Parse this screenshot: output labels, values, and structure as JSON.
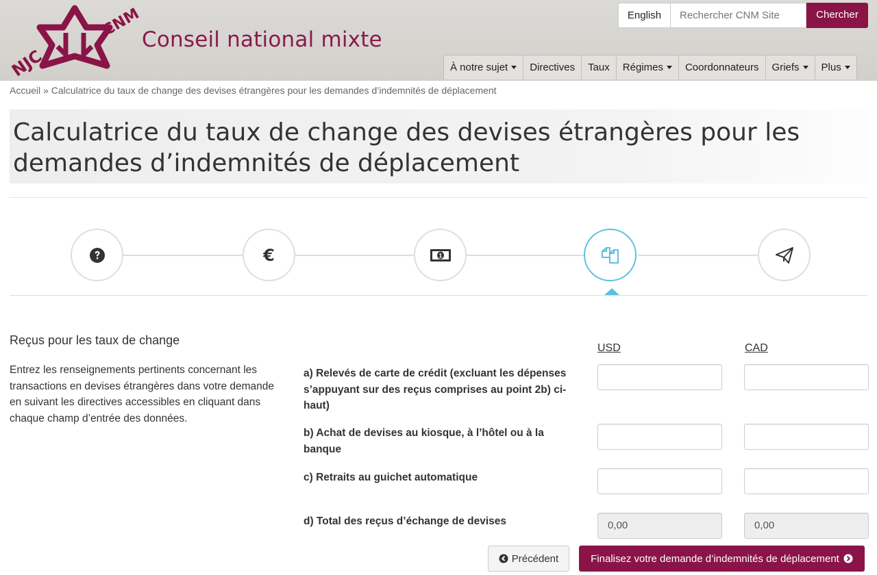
{
  "header": {
    "logo_left_text": "NJC",
    "logo_right_text": "CNM",
    "site_title": "Conseil national mixte",
    "lang_toggle": "English",
    "search_placeholder": "Rechercher CNM Site",
    "search_button": "Chercher",
    "brand_color": "#8a1447"
  },
  "nav": {
    "items": [
      {
        "label": "À notre sujet",
        "dropdown": true
      },
      {
        "label": "Directives",
        "dropdown": false
      },
      {
        "label": "Taux",
        "dropdown": false
      },
      {
        "label": "Régimes",
        "dropdown": true
      },
      {
        "label": "Coordonnateurs",
        "dropdown": false
      },
      {
        "label": "Griefs",
        "dropdown": true
      },
      {
        "label": "Plus",
        "dropdown": true
      }
    ]
  },
  "breadcrumb": {
    "home": "Accueil",
    "separator": "»",
    "current": "Calculatrice du taux de change des devises étrangères pour les demandes d’indemnités de déplacement"
  },
  "page_title": "Calculatrice du taux de change des devises étrangères pour les demandes d’indemnités de déplacement",
  "steps": [
    {
      "icon": "question-circle-icon",
      "active": false
    },
    {
      "icon": "euro-icon",
      "active": false
    },
    {
      "icon": "money-bill-icon",
      "active": false
    },
    {
      "icon": "copy-icon",
      "active": true
    },
    {
      "icon": "paper-plane-icon",
      "active": false
    }
  ],
  "form": {
    "section_title": "Reçus pour les taux de change",
    "section_description": "Entrez les renseignements pertinents concernant les transactions en devises étrangères dans votre demande en suivant les directives accessibles en cliquant dans chaque champ d’entrée des données.",
    "columns": [
      "USD",
      "CAD"
    ],
    "rows": [
      {
        "label": "a) Relevés de carte de crédit (excluant les dépenses s’appuyant sur des reçus comprises au point 2b) ci-haut)",
        "usd": "",
        "cad": ""
      },
      {
        "label": "b) Achat de devises au kiosque, à l’hôtel ou à la banque",
        "usd": "",
        "cad": ""
      },
      {
        "label": "c) Retraits au guichet automatique",
        "usd": "",
        "cad": ""
      },
      {
        "label": "d) Total des reçus d’échange de devises",
        "usd": "0,00",
        "cad": "0,00"
      }
    ],
    "prev_button": "Précédent",
    "next_button": "Finalisez votre demande d’indemnités de déplacement"
  }
}
